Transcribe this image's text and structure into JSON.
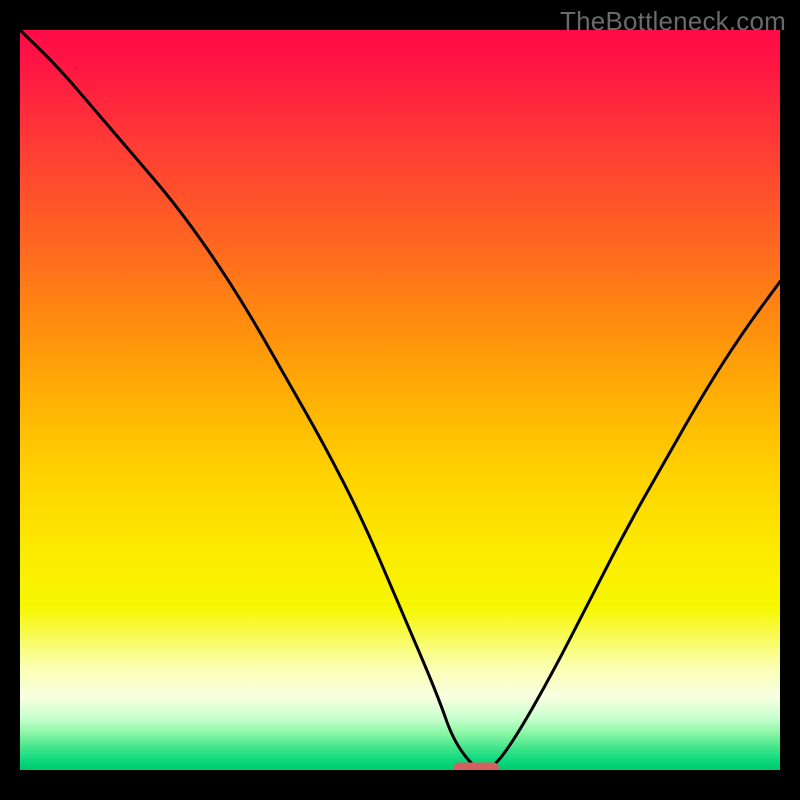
{
  "watermark": "TheBottleneck.com",
  "chart_data": {
    "type": "line",
    "title": "",
    "xlabel": "",
    "ylabel": "",
    "xlim": [
      0,
      100
    ],
    "ylim": [
      0,
      100
    ],
    "background_gradient": {
      "direction": "vertical",
      "stops": [
        {
          "pos": 0,
          "color": "#ff0b47"
        },
        {
          "pos": 16,
          "color": "#ff3d35"
        },
        {
          "pos": 30,
          "color": "#ff6a1f"
        },
        {
          "pos": 50,
          "color": "#ffb104"
        },
        {
          "pos": 70,
          "color": "#fcea00"
        },
        {
          "pos": 86,
          "color": "#faffb0"
        },
        {
          "pos": 93,
          "color": "#c8ffcf"
        },
        {
          "pos": 100,
          "color": "#00c86f"
        }
      ]
    },
    "series": [
      {
        "name": "bottleneck-curve",
        "x": [
          0,
          5,
          10,
          15,
          20,
          25,
          30,
          35,
          40,
          45,
          50,
          55,
          57,
          60,
          62,
          65,
          70,
          75,
          80,
          85,
          90,
          95,
          100
        ],
        "y": [
          100,
          95,
          89,
          83,
          77,
          70,
          62,
          53,
          44,
          34,
          22,
          10,
          4,
          0,
          0,
          4,
          13,
          23,
          33,
          42,
          51,
          59,
          66
        ]
      }
    ],
    "marker": {
      "name": "optimal-range",
      "shape": "capsule",
      "x_center": 60,
      "y": 0,
      "width": 6,
      "color": "#d46060"
    }
  }
}
